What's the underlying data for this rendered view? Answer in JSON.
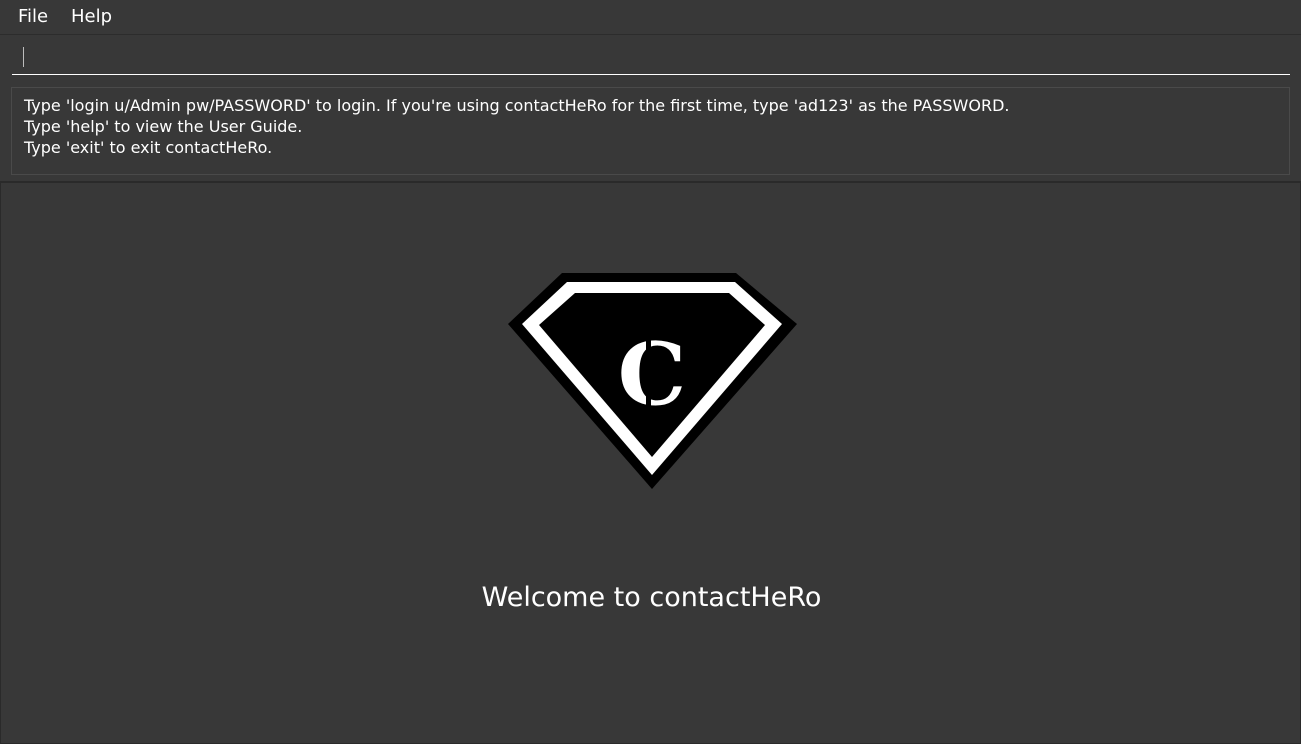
{
  "menu": {
    "file_label": "File",
    "help_label": "Help"
  },
  "command": {
    "value": "",
    "placeholder": ""
  },
  "result": {
    "lines": [
      "Type 'login u/Admin pw/PASSWORD' to login. If you're using contactHeRo for the first time, type 'ad123' as the PASSWORD.",
      "Type 'help' to view the User Guide.",
      "Type 'exit' to exit contactHeRo."
    ]
  },
  "logo": {
    "letter": "C",
    "icon": "diamond-shield-logo"
  },
  "welcome": {
    "text": "Welcome to contactHeRo"
  },
  "colors": {
    "background": "#383838",
    "text": "#ffffff",
    "logo_dark": "#000000",
    "logo_light": "#ffffff"
  }
}
